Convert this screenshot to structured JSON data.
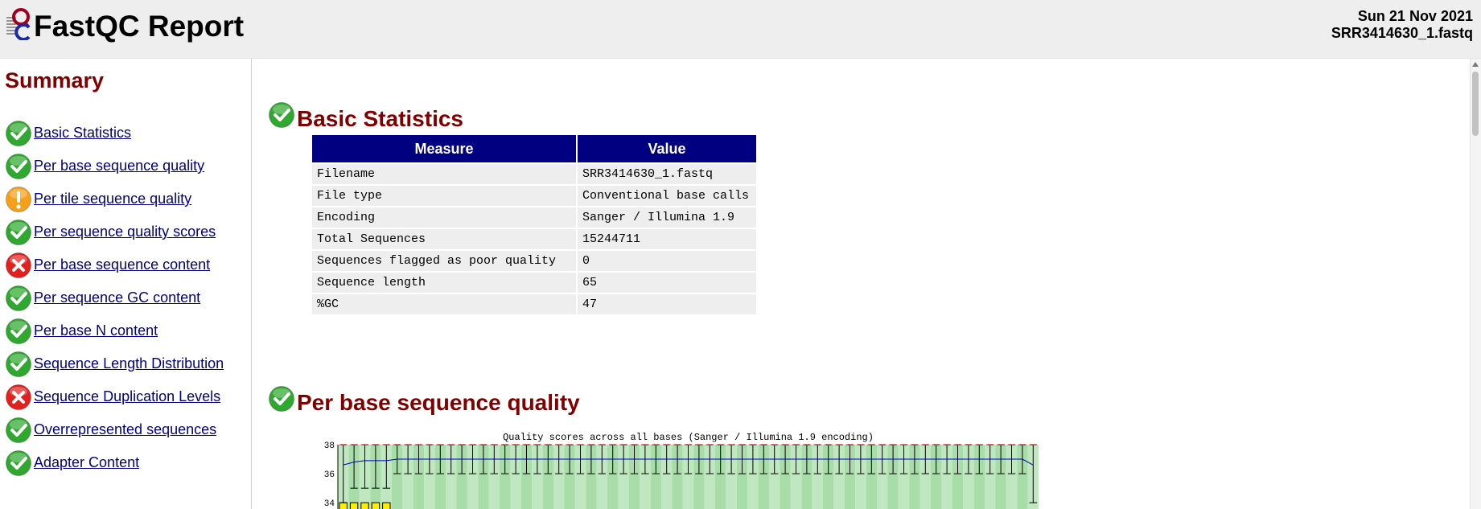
{
  "header": {
    "title": "FastQC Report",
    "date": "Sun 21 Nov 2021",
    "filename": "SRR3414630_1.fastq"
  },
  "colors": {
    "pass": "#2fa830",
    "warn": "#f5a01a",
    "fail": "#e0221f",
    "heading": "#800000",
    "table_header": "#000080",
    "link": "#000080"
  },
  "sidebar": {
    "title": "Summary",
    "items": [
      {
        "label": "Basic Statistics",
        "status": "pass"
      },
      {
        "label": "Per base sequence quality",
        "status": "pass"
      },
      {
        "label": "Per tile sequence quality",
        "status": "warn"
      },
      {
        "label": "Per sequence quality scores",
        "status": "pass"
      },
      {
        "label": "Per base sequence content",
        "status": "fail"
      },
      {
        "label": "Per sequence GC content",
        "status": "pass"
      },
      {
        "label": "Per base N content",
        "status": "pass"
      },
      {
        "label": "Sequence Length Distribution",
        "status": "pass"
      },
      {
        "label": "Sequence Duplication Levels",
        "status": "fail"
      },
      {
        "label": "Overrepresented sequences",
        "status": "pass"
      },
      {
        "label": "Adapter Content",
        "status": "pass"
      }
    ]
  },
  "main": {
    "basic_stats": {
      "title": "Basic Statistics",
      "status": "pass",
      "columns": [
        "Measure",
        "Value"
      ],
      "rows": [
        [
          "Filename",
          "SRR3414630_1.fastq"
        ],
        [
          "File type",
          "Conventional base calls"
        ],
        [
          "Encoding",
          "Sanger / Illumina 1.9"
        ],
        [
          "Total Sequences",
          "15244711"
        ],
        [
          "Sequences flagged as poor quality",
          "0"
        ],
        [
          "Sequence length",
          "65"
        ],
        [
          "%GC",
          "47"
        ]
      ]
    },
    "per_base_quality": {
      "title": "Per base sequence quality",
      "status": "pass"
    }
  },
  "chart_data": {
    "type": "box",
    "title": "Quality scores across all bases (Sanger / Illumina 1.9 encoding)",
    "y_ticks": [
      38,
      36,
      34
    ],
    "ylim": [
      33.9,
      38
    ],
    "positions": 65,
    "mean": [
      36.6,
      36.8,
      36.9,
      36.9,
      36.9,
      37.0,
      37.0,
      37.0,
      37.0,
      37.0,
      37.0,
      37.0,
      37.0,
      37.0,
      37.0,
      37.0,
      37.0,
      37.0,
      37.0,
      37.0,
      37.0,
      37.0,
      37.0,
      37.0,
      37.0,
      37.0,
      37.0,
      37.0,
      37.0,
      37.0,
      37.0,
      37.0,
      37.0,
      37.0,
      37.0,
      37.0,
      37.0,
      37.0,
      37.0,
      37.0,
      37.0,
      37.0,
      37.0,
      37.0,
      37.0,
      37.0,
      37.0,
      37.0,
      37.0,
      37.0,
      37.0,
      37.0,
      37.0,
      37.0,
      37.0,
      37.0,
      37.0,
      37.0,
      37.0,
      37.0,
      37.0,
      37.0,
      37.0,
      37.0,
      36.6
    ],
    "upper_whisker": [
      38,
      38,
      38,
      38,
      38,
      38,
      38,
      38,
      38,
      38,
      38,
      38,
      38,
      38,
      38,
      38,
      38,
      38,
      38,
      38,
      38,
      38,
      38,
      38,
      38,
      38,
      38,
      38,
      38,
      38,
      38,
      38,
      38,
      38,
      38,
      38,
      38,
      38,
      38,
      38,
      38,
      38,
      38,
      38,
      38,
      38,
      38,
      38,
      38,
      38,
      38,
      38,
      38,
      38,
      38,
      38,
      38,
      38,
      38,
      38,
      38,
      38,
      38,
      38,
      38
    ],
    "lower_whisker": [
      34,
      35,
      35,
      35,
      35,
      36,
      36,
      36,
      36,
      36,
      36,
      36,
      36,
      36,
      36,
      36,
      36,
      36,
      36,
      36,
      36,
      36,
      36,
      36,
      36,
      36,
      36,
      36,
      36,
      36,
      36,
      36,
      36,
      36,
      36,
      36,
      36,
      36,
      36,
      36,
      36,
      36,
      36,
      36,
      36,
      36,
      36,
      36,
      36,
      36,
      36,
      36,
      36,
      36,
      36,
      36,
      36,
      36,
      36,
      36,
      36,
      36,
      36,
      36,
      34
    ],
    "box_low_positions": [
      1,
      2,
      3,
      4,
      5
    ]
  }
}
